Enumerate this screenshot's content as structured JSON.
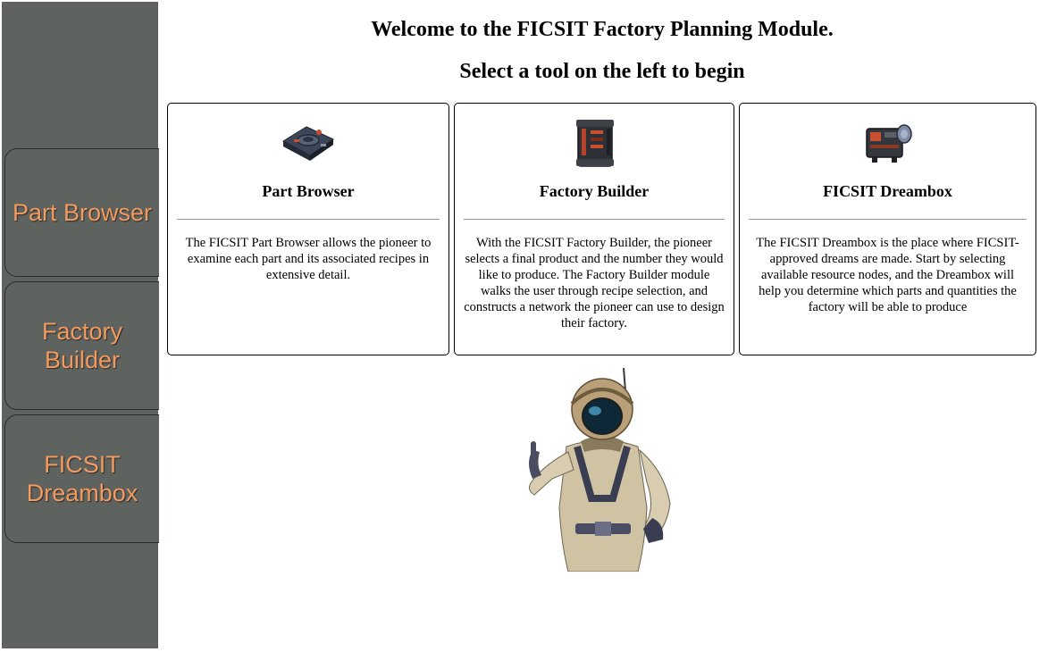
{
  "sidebar": {
    "items": [
      {
        "label": "Part Browser"
      },
      {
        "label": "Factory\nBuilder"
      },
      {
        "label": "FICSIT\nDreambox"
      }
    ]
  },
  "main": {
    "welcome_heading": "Welcome to the FICSIT Factory Planning Module.",
    "subheading": "Select a tool on the left to begin",
    "cards": [
      {
        "title": "Part Browser",
        "icon": "part-icon",
        "description": "The FICSIT Part Browser allows the pioneer to examine each part and its associated recipes in extensive detail."
      },
      {
        "title": "Factory Builder",
        "icon": "factory-building-icon",
        "description": "With the FICSIT Factory Builder, the pioneer selects a final product and the number they would like to produce. The Factory Builder module walks the user through recipe selection, and constructs a network the pioneer can use to design their factory."
      },
      {
        "title": "FICSIT Dreambox",
        "icon": "dreambox-machine-icon",
        "description": "The FICSIT Dreambox is the place where FICSIT-approved dreams are made. Start by selecting available resource nodes, and the Dreambox will help you determine which parts and quantities the factory will be able to produce"
      }
    ],
    "mascot": "pioneer-character-image"
  },
  "colors": {
    "sidebar_bg": "#5e6360",
    "nav_text": "#f39a5e",
    "card_border": "#000000",
    "divider": "#9a9a9a"
  }
}
